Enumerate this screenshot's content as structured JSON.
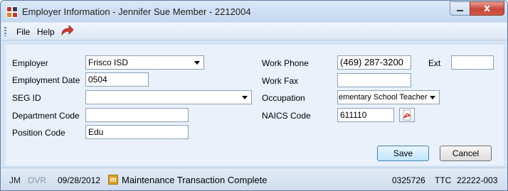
{
  "window": {
    "title": "Employer Information - Jennifer Sue Member - 2212004",
    "close_glyph": "x"
  },
  "menu": {
    "file": "File",
    "help": "Help"
  },
  "form": {
    "employer_label": "Employer",
    "employer_value": "Frisco ISD",
    "employment_date_label": "Employment Date",
    "employment_date_value": "0504",
    "seg_id_label": "SEG ID",
    "seg_id_value": "",
    "department_code_label": "Department Code",
    "department_code_value": "",
    "position_code_label": "Position Code",
    "position_code_value": "Edu",
    "work_phone_label": "Work Phone",
    "work_phone_value": "(469) 287-3200",
    "ext_label": "Ext",
    "ext_value": "",
    "work_fax_label": "Work Fax",
    "work_fax_value": "",
    "occupation_label": "Occupation",
    "occupation_value": "ementary School Teacher",
    "naics_code_label": "NAICS Code",
    "naics_code_value": "611110"
  },
  "buttons": {
    "save": "Save",
    "cancel": "Cancel"
  },
  "status": {
    "user": "JM",
    "ovr": "OVR",
    "date": "09/28/2012",
    "badge": "m",
    "message": "Maintenance Transaction Complete",
    "id": "0325726",
    "ttc": "TTC",
    "code": "22222-003"
  },
  "colors": {
    "accent": "#3c7fb1",
    "badge": "#d9a21e",
    "close": "#c7473a"
  }
}
